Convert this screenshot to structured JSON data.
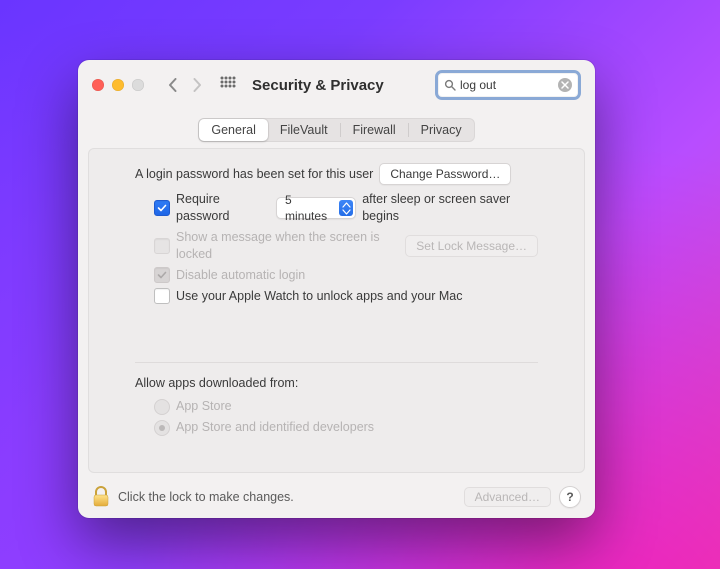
{
  "window": {
    "title": "Security & Privacy"
  },
  "search": {
    "query": "log out"
  },
  "tabs": {
    "general": "General",
    "filevault": "FileVault",
    "firewall": "Firewall",
    "privacy": "Privacy",
    "selected": "general"
  },
  "general": {
    "login_password_set": "A login password has been set for this user",
    "change_password": "Change Password…",
    "require_password_label": "Require password",
    "require_password_checked": true,
    "delay_value": "5 minutes",
    "after_sleep": "after sleep or screen saver begins",
    "show_message_label": "Show a message when the screen is locked",
    "set_lock_message": "Set Lock Message…",
    "disable_auto_login": "Disable automatic login",
    "apple_watch_label": "Use your Apple Watch to unlock apps and your Mac",
    "allow_apps_label": "Allow apps downloaded from:",
    "appstore": "App Store",
    "appstore_identified": "App Store and identified developers"
  },
  "footer": {
    "lock_text": "Click the lock to make changes.",
    "advanced": "Advanced…",
    "help": "?"
  }
}
